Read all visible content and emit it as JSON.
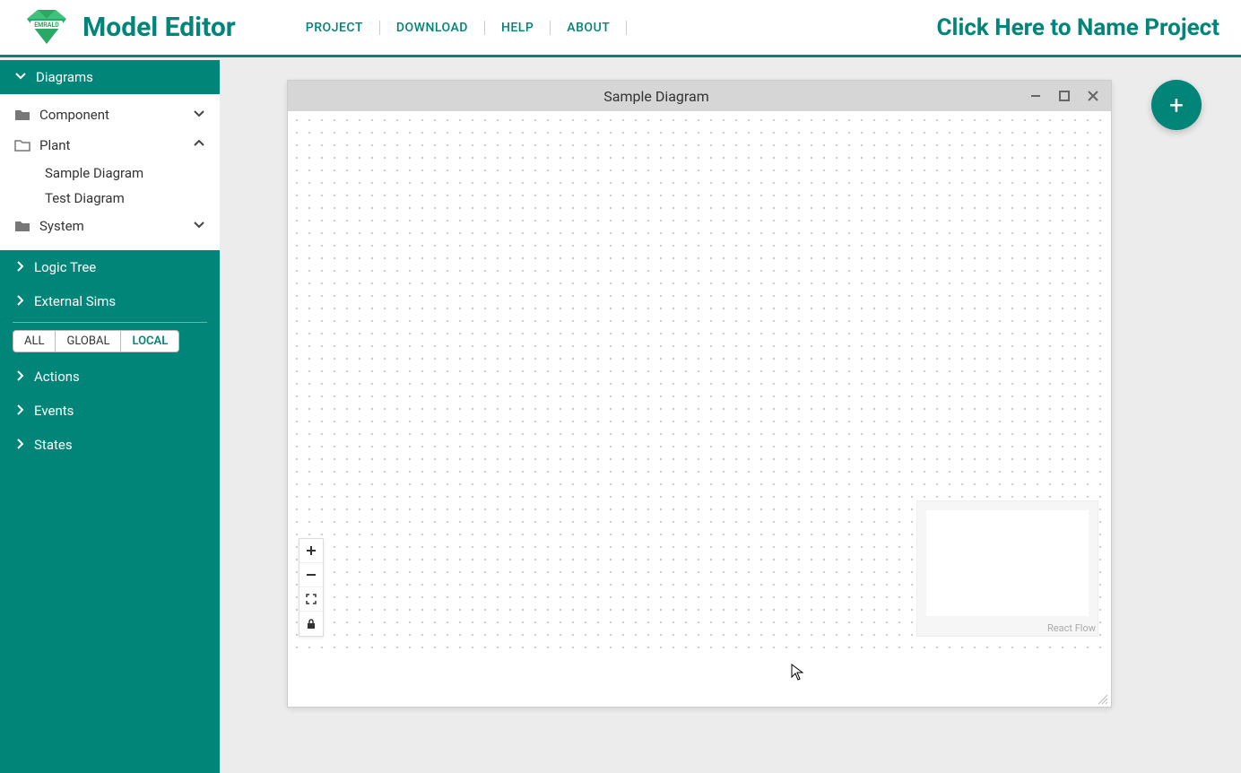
{
  "header": {
    "app_title": "Model Editor",
    "nav": [
      "PROJECT",
      "DOWNLOAD",
      "HELP",
      "ABOUT"
    ],
    "project_name": "Click Here to Name Project"
  },
  "sidebar": {
    "diagrams_label": "Diagrams",
    "folders": {
      "component": "Component",
      "plant": "Plant",
      "system": "System"
    },
    "plant_children": [
      "Sample Diagram",
      "Test Diagram"
    ],
    "sections": {
      "logic_tree": "Logic Tree",
      "ext_sims": "External Sims",
      "actions": "Actions",
      "events": "Events",
      "states": "States"
    },
    "scope": {
      "all": "ALL",
      "global": "GLOBAL",
      "local": "LOCAL"
    }
  },
  "window": {
    "title": "Sample Diagram",
    "rf_attribution": "React Flow"
  }
}
